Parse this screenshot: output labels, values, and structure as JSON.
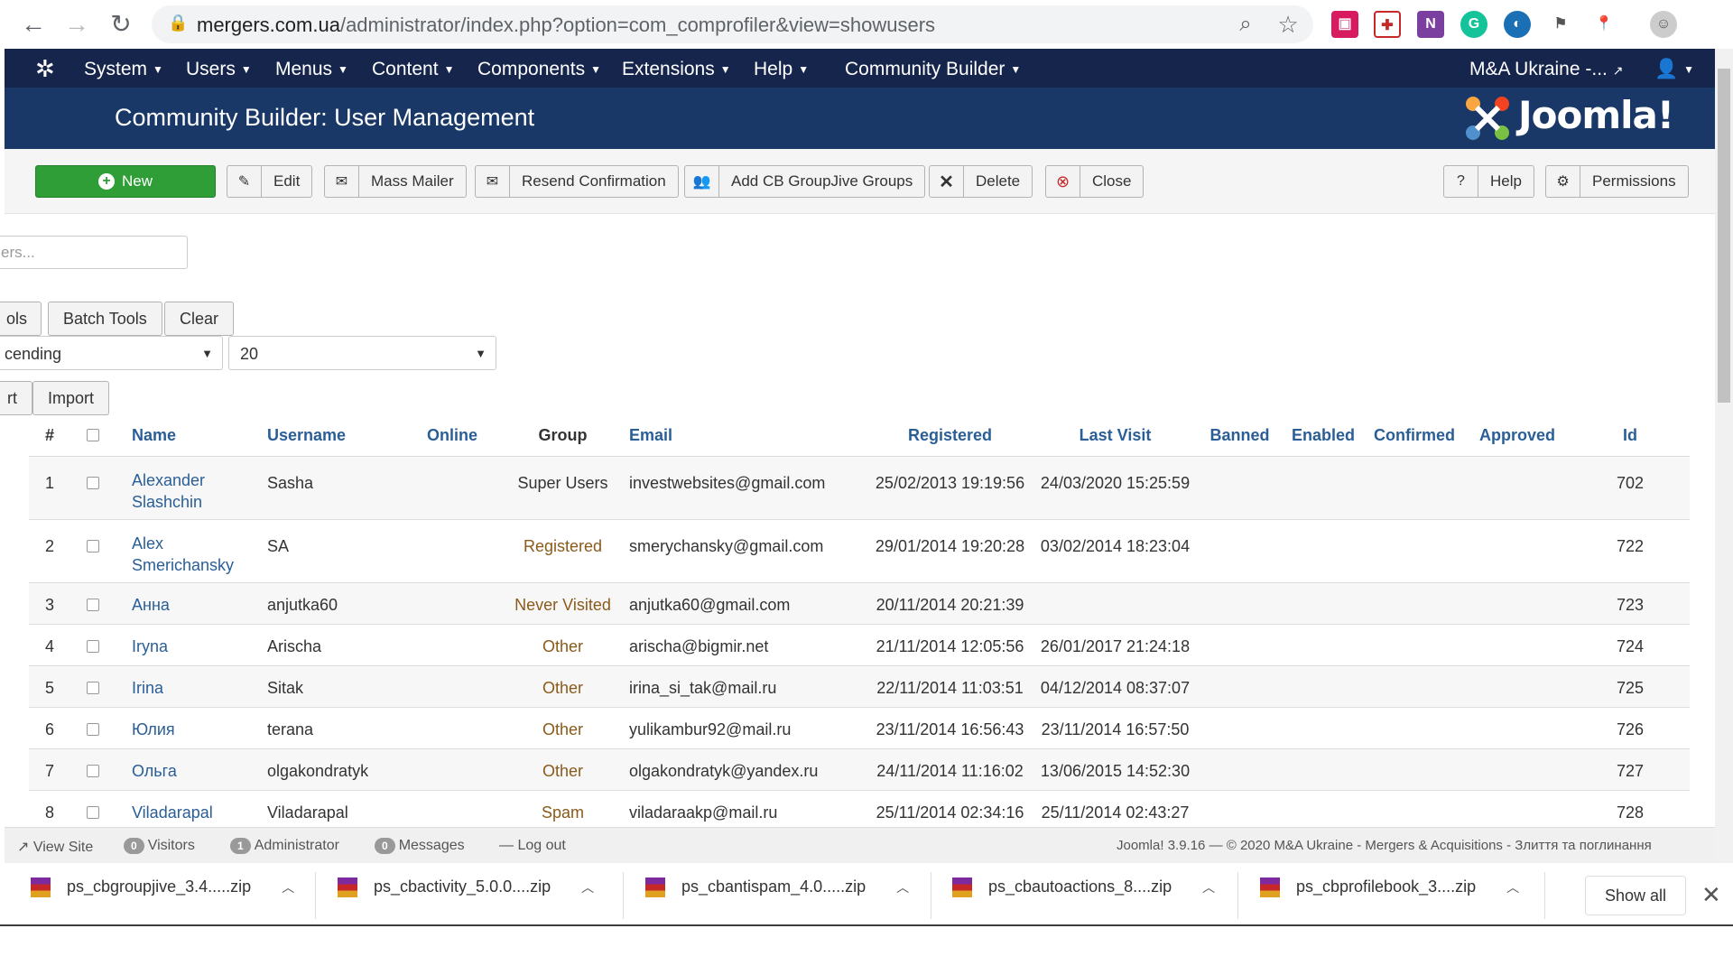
{
  "browser": {
    "url_host": "mergers.com.ua",
    "url_path": "/administrator/index.php?option=com_comprofiler&view=showusers"
  },
  "topnav": {
    "items": [
      "System",
      "Users",
      "Menus",
      "Content",
      "Components",
      "Extensions",
      "Help",
      "Community Builder"
    ],
    "site_name": "M&A Ukraine -..."
  },
  "header": {
    "title": "Community Builder: User Management",
    "logo_text": "Joomla!"
  },
  "toolbar": {
    "new": "New",
    "edit": "Edit",
    "mass_mailer": "Mass Mailer",
    "resend": "Resend Confirmation",
    "add_groups": "Add CB GroupJive Groups",
    "delete": "Delete",
    "close": "Close",
    "help": "Help",
    "permissions": "Permissions"
  },
  "filters": {
    "search_placeholder": "ers...",
    "tools_label": "ols",
    "batch_label": "Batch Tools",
    "clear_label": "Clear",
    "order_value": "cending",
    "limit_value": "20",
    "export_label": "rt",
    "import_label": "Import"
  },
  "table": {
    "headers": {
      "num": "#",
      "name": "Name",
      "username": "Username",
      "online": "Online",
      "group": "Group",
      "email": "Email",
      "registered": "Registered",
      "last_visit": "Last Visit",
      "banned": "Banned",
      "enabled": "Enabled",
      "confirmed": "Confirmed",
      "approved": "Approved",
      "id": "Id"
    },
    "rows": [
      {
        "num": "1",
        "name": "Alexander Slashchin",
        "username": "Sasha",
        "group": "Super Users",
        "email": "investwebsites@gmail.com",
        "registered": "25/02/2013 19:19:56",
        "last_visit": "24/03/2020 15:25:59",
        "id": "702"
      },
      {
        "num": "2",
        "name": "Alex Smerichansky",
        "username": "SA",
        "group": "Registered",
        "email": "smerychansky@gmail.com",
        "registered": "29/01/2014 19:20:28",
        "last_visit": "03/02/2014 18:23:04",
        "id": "722"
      },
      {
        "num": "3",
        "name": "Анна",
        "username": "anjutka60",
        "group": "Never Visited",
        "email": "anjutka60@gmail.com",
        "registered": "20/11/2014 20:21:39",
        "last_visit": "",
        "id": "723"
      },
      {
        "num": "4",
        "name": "Iryna",
        "username": "Arischa",
        "group": "Other",
        "email": "arischa@bigmir.net",
        "registered": "21/11/2014 12:05:56",
        "last_visit": "26/01/2017 21:24:18",
        "id": "724"
      },
      {
        "num": "5",
        "name": "Irina",
        "username": "Sitak",
        "group": "Other",
        "email": "irina_si_tak@mail.ru",
        "registered": "22/11/2014 11:03:51",
        "last_visit": "04/12/2014 08:37:07",
        "id": "725"
      },
      {
        "num": "6",
        "name": "Юлия",
        "username": "terana",
        "group": "Other",
        "email": "yulikambur92@mail.ru",
        "registered": "23/11/2014 16:56:43",
        "last_visit": "23/11/2014 16:57:50",
        "id": "726"
      },
      {
        "num": "7",
        "name": "Ольга",
        "username": "olgakondratyk",
        "group": "Other",
        "email": "olgakondratyk@yandex.ru",
        "registered": "24/11/2014 11:16:02",
        "last_visit": "13/06/2015 14:52:30",
        "id": "727"
      },
      {
        "num": "8",
        "name": "Viladarapal",
        "username": "Viladarapal",
        "group": "Spam",
        "email": "viladaraakp@mail.ru",
        "registered": "25/11/2014 02:34:16",
        "last_visit": "25/11/2014 02:43:27",
        "id": "728"
      }
    ]
  },
  "statusbar": {
    "view_site": "View Site",
    "visitors_count": "0",
    "visitors_label": "Visitors",
    "admin_count": "1",
    "admin_label": "Administrator",
    "messages_count": "0",
    "messages_label": "Messages",
    "logout": "Log out",
    "version": "Joomla! 3.9.16",
    "copyright": "© 2020 M&A Ukraine - Mergers & Acquisitions - Злиття та поглинання"
  },
  "downloads": {
    "files": [
      "ps_cbgroupjive_3.4.....zip",
      "ps_cbactivity_5.0.0....zip",
      "ps_cbantispam_4.0.....zip",
      "ps_cbautoactions_8....zip",
      "ps_cbprofilebook_3....zip"
    ],
    "show_all": "Show all"
  }
}
